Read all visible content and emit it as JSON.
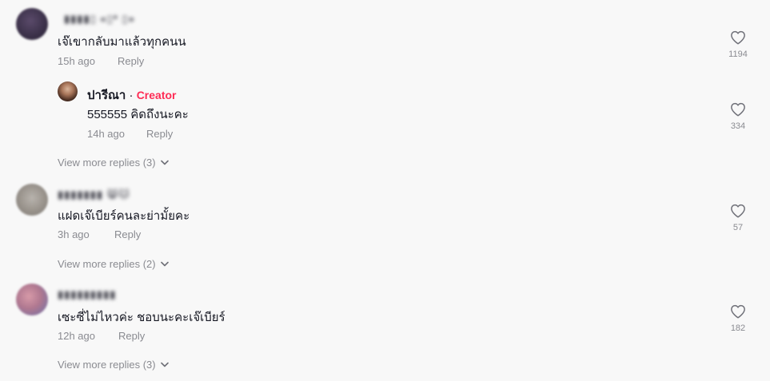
{
  "comments": [
    {
      "username": "▮▮▮▮▯  «▯* ▯»",
      "text": "เจ๊เขากลับมาแล้วทุกคนน",
      "time": "15h ago",
      "reply_label": "Reply",
      "likes": "1194"
    },
    {
      "username": "ปารีณา",
      "creator_sep": "·",
      "creator_label": "Creator",
      "text": "555555 คิดถึงนะคะ",
      "time": "14h ago",
      "reply_label": "Reply",
      "likes": "334",
      "view_more": "View more replies (3)"
    },
    {
      "username": "▮▮▮▮▮▮▮ 😸🐱",
      "text": "แฝดเจ๊เบียร์คนละย่ามั้ยคะ",
      "time": "3h ago",
      "reply_label": "Reply",
      "likes": "57",
      "view_more": "View more replies (2)"
    },
    {
      "username": "▮▮▮▮▮▮▮▮▮",
      "text": "เซะซี่ไม่ไหวค่ะ ชอบนะคะเจ๊เบียร์",
      "time": "12h ago",
      "reply_label": "Reply",
      "likes": "182",
      "view_more": "View more replies (3)"
    }
  ],
  "colors": {
    "background": "#f8f8f8",
    "text": "#161823",
    "muted": "#8a8b91",
    "creator": "#fe2c55"
  },
  "icons": {
    "like": "heart-outline-icon",
    "expand": "chevron-down-icon"
  }
}
